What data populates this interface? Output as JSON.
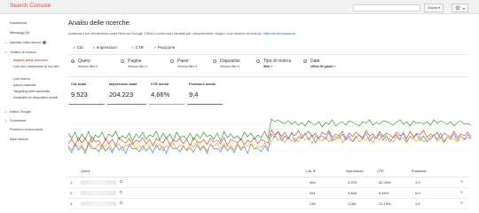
{
  "app": {
    "title": "Search Console",
    "lang_button": "Guida"
  },
  "sidebar": {
    "items": [
      {
        "label": "Dashboard"
      },
      {
        "label": "Messaggi (5)"
      },
      {
        "label": "Aspetto nella ricerca"
      },
      {
        "label": "Traffico di ricerca"
      },
      {
        "label": "Analisi delle ricerche"
      },
      {
        "label": "Link che rimandano al tuo sito"
      },
      {
        "label": "Link interni"
      },
      {
        "label": "Azioni manuali"
      },
      {
        "label": "Targeting internazionale"
      },
      {
        "label": "Usabilità sui dispositivi mobili"
      },
      {
        "label": "Indice Google"
      },
      {
        "label": "Scansione"
      },
      {
        "label": "Problemi di sicurezza"
      },
      {
        "label": "Altre risorse"
      }
    ]
  },
  "main": {
    "title": "Analisi delle ricerche",
    "intro": "Analizza il tuo rendimento sulla Ricerca Google. Filtra e confronta i risultati per comprendere meglio i tuoi schemi di ricerca.",
    "intro_link": "Ulteriori informazioni."
  },
  "metrics_toggle": [
    {
      "label": "Clic",
      "checked": true
    },
    {
      "label": "Impressioni",
      "checked": true
    },
    {
      "label": "CTR",
      "checked": true
    },
    {
      "label": "Posizione",
      "checked": true
    }
  ],
  "group_by": [
    {
      "label": "Query",
      "filter": "Nessun filtro",
      "selected": true
    },
    {
      "label": "Pagine",
      "filter": "Nessun filtro",
      "selected": false
    },
    {
      "label": "Paesi",
      "filter": "Nessun filtro",
      "selected": false
    },
    {
      "label": "Dispositivi",
      "filter": "Nessun filtro",
      "selected": false
    },
    {
      "label": "Tipo di ricerca",
      "filter": "Web",
      "selected": false
    },
    {
      "label": "Date",
      "filter": "Ultimi 90 giorni",
      "selected": false
    }
  ],
  "cards": [
    {
      "label": "Clic totali",
      "value": "9.523",
      "color": "#4a86e8"
    },
    {
      "label": "Impressioni totali",
      "value": "204.223",
      "color": "#dd4b39"
    },
    {
      "label": "CTR medio",
      "value": "4,66%",
      "color": "#f0a30a"
    },
    {
      "label": "Posizione media",
      "value": "9,4",
      "color": "#3a9a3a"
    }
  ],
  "chart_data": {
    "type": "line",
    "series": [
      {
        "color": "#3a9a3a",
        "values": [
          34,
          28,
          35,
          25,
          33,
          27,
          36,
          24,
          32,
          29,
          35,
          26,
          33,
          30,
          36,
          27,
          31,
          28,
          34,
          25,
          33,
          29,
          35,
          27,
          32,
          30,
          36,
          26,
          34,
          28,
          33,
          25,
          35,
          29,
          31,
          27,
          34,
          26,
          33,
          28,
          35,
          30,
          32,
          27,
          34,
          25,
          36,
          29,
          33,
          28,
          31,
          26,
          35,
          30,
          34,
          27,
          32,
          29,
          36,
          28,
          50,
          47,
          49,
          46,
          45,
          48,
          44,
          47,
          43,
          46,
          42,
          48,
          45,
          43,
          47,
          41,
          46,
          44,
          49,
          42,
          45,
          47,
          43,
          48,
          46,
          44,
          42,
          47,
          45,
          49,
          43,
          46,
          44,
          48,
          47,
          45,
          43,
          46,
          49,
          44,
          47,
          42,
          48,
          45,
          46,
          44,
          47,
          43,
          49,
          45,
          48,
          46,
          44,
          47,
          42,
          46,
          48,
          44,
          45,
          43
        ]
      },
      {
        "color": "#dd4b39",
        "values": [
          22,
          27,
          20,
          29,
          23,
          28,
          21,
          30,
          24,
          26,
          19,
          28,
          22,
          27,
          20,
          29,
          25,
          23,
          28,
          21,
          26,
          24,
          29,
          22,
          27,
          20,
          28,
          25,
          23,
          29,
          21,
          26,
          24,
          28,
          22,
          27,
          20,
          29,
          25,
          23,
          27,
          21,
          28,
          24,
          26,
          22,
          29,
          20,
          27,
          25,
          23,
          28,
          21,
          26,
          24,
          29,
          22,
          27,
          25,
          23,
          38,
          32,
          36,
          30,
          35,
          28,
          34,
          31,
          37,
          29,
          33,
          36,
          30,
          34,
          28,
          35,
          32,
          37,
          29,
          33,
          31,
          36,
          28,
          34,
          30,
          35,
          32,
          29,
          37,
          31,
          33,
          28,
          36,
          30,
          34,
          32,
          29,
          35,
          31,
          33,
          28,
          36,
          30,
          34,
          32,
          37,
          29,
          33,
          31,
          35,
          28,
          34,
          32,
          30,
          36,
          29,
          33,
          31,
          35,
          30
        ]
      },
      {
        "color": "#4a86e8",
        "values": [
          18,
          12,
          21,
          15,
          19,
          11,
          22,
          16,
          17,
          13,
          20,
          14,
          18,
          12,
          21,
          15,
          19,
          11,
          22,
          16,
          17,
          13,
          20,
          14,
          18,
          12,
          21,
          15,
          19,
          11,
          22,
          16,
          17,
          13,
          20,
          14,
          18,
          12,
          21,
          15,
          19,
          11,
          22,
          16,
          17,
          13,
          20,
          14,
          18,
          12,
          21,
          15,
          19,
          11,
          22,
          16,
          17,
          13,
          20,
          14,
          33,
          29,
          36,
          25,
          31,
          27,
          35,
          24,
          30,
          28,
          34,
          26,
          32,
          23,
          29,
          31,
          27,
          35,
          25,
          30,
          28,
          33,
          26,
          31,
          24,
          29,
          32,
          27,
          34,
          25,
          30,
          28,
          33,
          26,
          31,
          24,
          29,
          32,
          27,
          35,
          25,
          30,
          28,
          33,
          26,
          31,
          24,
          29,
          32,
          27,
          34,
          25,
          30,
          28,
          33,
          26,
          31,
          27,
          32,
          28
        ]
      },
      {
        "color": "#f0a30a",
        "values": [
          20,
          15,
          23,
          18,
          21,
          14,
          24,
          19,
          17,
          22,
          16,
          20,
          23,
          15,
          19,
          22,
          14,
          21,
          18,
          24,
          16,
          20,
          15,
          23,
          19,
          21,
          17,
          22,
          14,
          20,
          18,
          23,
          16,
          21,
          19,
          15,
          22,
          18,
          24,
          17,
          20,
          14,
          21,
          19,
          23,
          16,
          22,
          18,
          20,
          15,
          24,
          17,
          21,
          19,
          22,
          16,
          20,
          18,
          23,
          17,
          24,
          31,
          26,
          29,
          23,
          30,
          25,
          28,
          24,
          33,
          26,
          29,
          22,
          31,
          27,
          25,
          30,
          24,
          28,
          26,
          32,
          23,
          29,
          27,
          25,
          31,
          24,
          28,
          26,
          30,
          23,
          29,
          27,
          32,
          25,
          28,
          24,
          30,
          26,
          29,
          23,
          31,
          27,
          25,
          30,
          24,
          28,
          26,
          32,
          25,
          29,
          23,
          30,
          27,
          28,
          24,
          31,
          26,
          29,
          27
        ]
      }
    ],
    "ylim": [
      0,
      58
    ]
  },
  "table": {
    "headers": {
      "query": "Query",
      "clicks": "Clic ▼",
      "impressions": "Impressioni",
      "ctr": "CTR",
      "position": "Posizione"
    },
    "rows": [
      {
        "index": "1",
        "clicks": "963",
        "impressions": "2.979",
        "ctr": "32,33%",
        "position": "1,0"
      },
      {
        "index": "2",
        "clicks": "251",
        "impressions": "3.845",
        "ctr": "6,53%",
        "position": "6,0"
      },
      {
        "index": "3",
        "clicks": "230",
        "impressions": "1.061",
        "ctr": "22,15%",
        "position": "1,6"
      }
    ]
  }
}
